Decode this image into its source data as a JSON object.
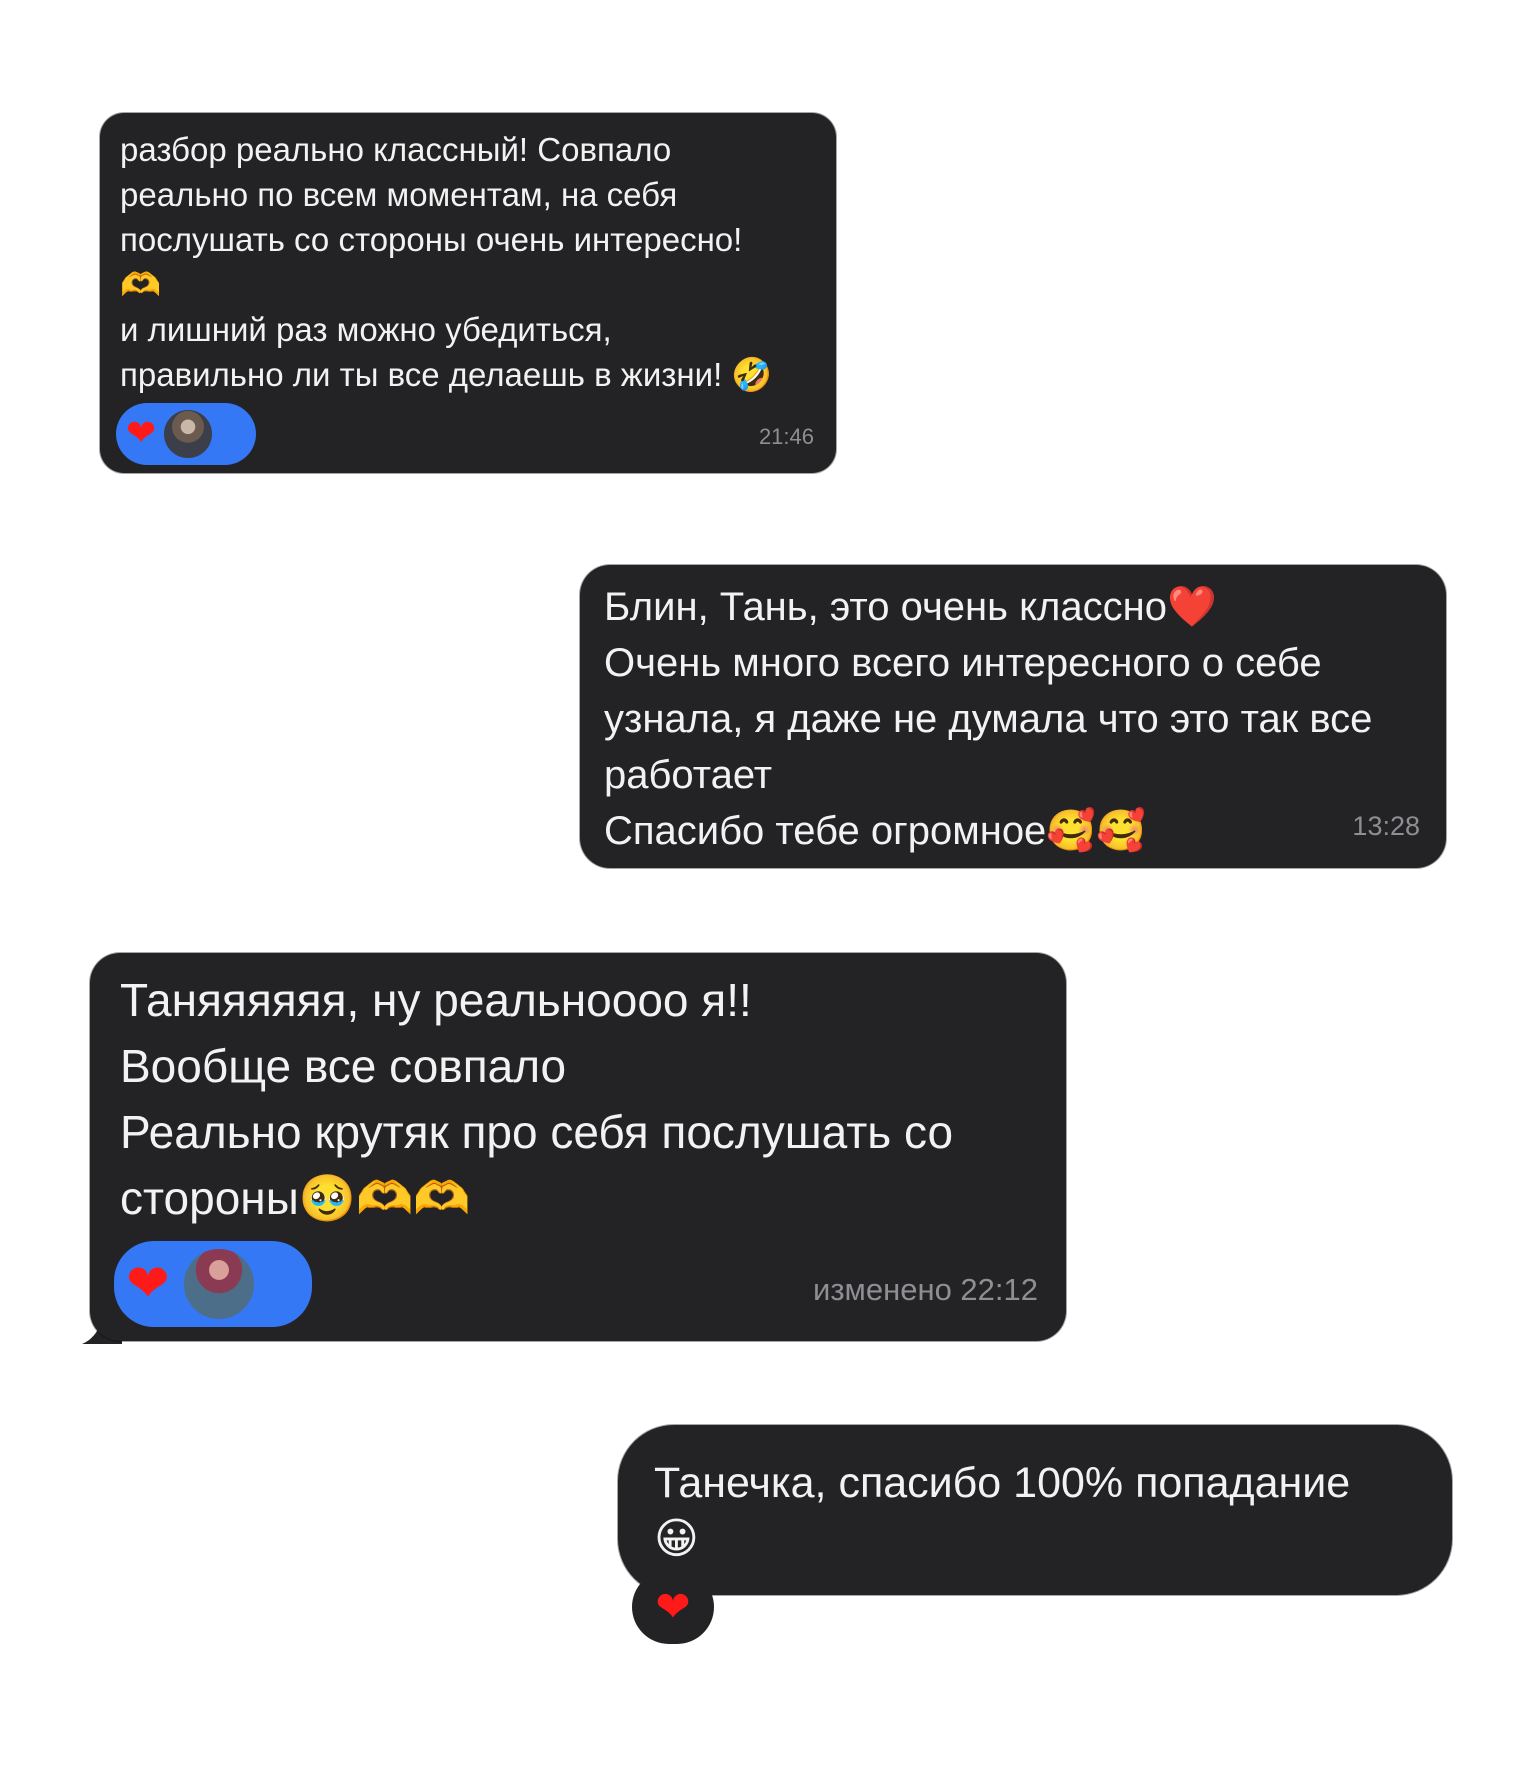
{
  "messages": [
    {
      "lines": [
        "разбор реально классный! Совпало",
        "реально по всем моментам, на себя",
        "послушать со стороны очень интересно!",
        "🫶",
        "и лишний раз можно убедиться,",
        "правильно ли ты все делаешь в жизни! 🤣"
      ],
      "time": "21:46",
      "reaction": "❤"
    },
    {
      "lines": [
        "Блин, Тань, это очень классно❤️",
        "Очень много всего интересного о себе",
        "узнала, я даже не думала что это так все",
        "работает",
        "Спасибо тебе огромное🥰🥰"
      ],
      "time": "13:28"
    },
    {
      "lines": [
        "Таняяяяяя, ну реальноооо я!!",
        "Вообще все совпало",
        "Реально крутяк про себя послушать со",
        "стороны🥹🫶🫶"
      ],
      "time": "изменено 22:12",
      "reaction": "❤"
    },
    {
      "lines": [
        "Танечка, спасибо 100% попадание",
        "😀"
      ],
      "reaction": "❤"
    }
  ],
  "colors": {
    "bubble": "#232325",
    "text": "#f2f2f2",
    "time": "#8e8e93",
    "reaction_bg": "#3478f6",
    "heart": "#ff1a1a"
  }
}
